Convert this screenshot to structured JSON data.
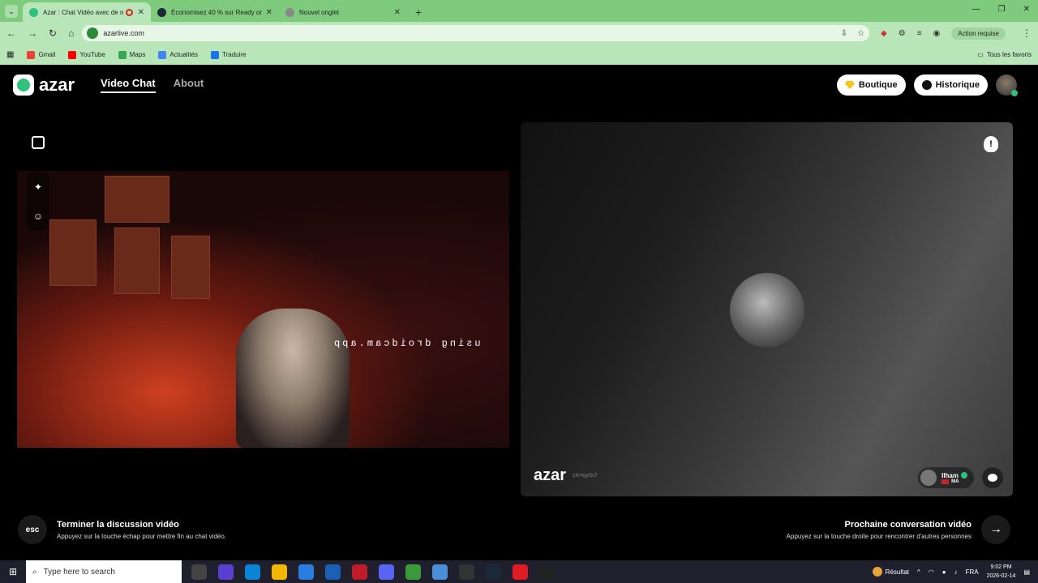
{
  "browser": {
    "tabs": [
      {
        "title": "Azar : Chat Vidéo avec de n",
        "active": true,
        "color": "#2ec27e"
      },
      {
        "title": "Économisez 40 % sur Ready or",
        "active": false,
        "color": "#1b2838"
      },
      {
        "title": "Nouvel onglet",
        "active": false,
        "color": "#888888"
      }
    ],
    "url": "azarlive.com",
    "action_required": "Action requise",
    "bookmarks": [
      "Gmail",
      "YouTube",
      "Maps",
      "Actualités",
      "Traduire"
    ],
    "all_favorites": "Tous les favoris"
  },
  "azar": {
    "brand": "azar",
    "nav": {
      "video_chat": "Video Chat",
      "about": "About"
    },
    "boutique": "Boutique",
    "history": "Historique",
    "watermark": "using droidcam.app",
    "peer_id": "1KrYqyI5c7",
    "peer_name": "Ilham",
    "peer_country": "MA",
    "end_key": "esc",
    "end_title": "Terminer la discussion vidéo",
    "end_sub": "Appuyez sur la touche échap pour mettre fin au chat vidéo.",
    "next_title": "Prochaine conversation vidéo",
    "next_sub": "Appuyez sur la touche droite pour rencontrer d'autres personnes"
  },
  "taskbar": {
    "search_placeholder": "Type here to search",
    "result_label": "Résultat",
    "lang": "FRA",
    "time": "9:02 PM",
    "date": "2026-02-14"
  }
}
